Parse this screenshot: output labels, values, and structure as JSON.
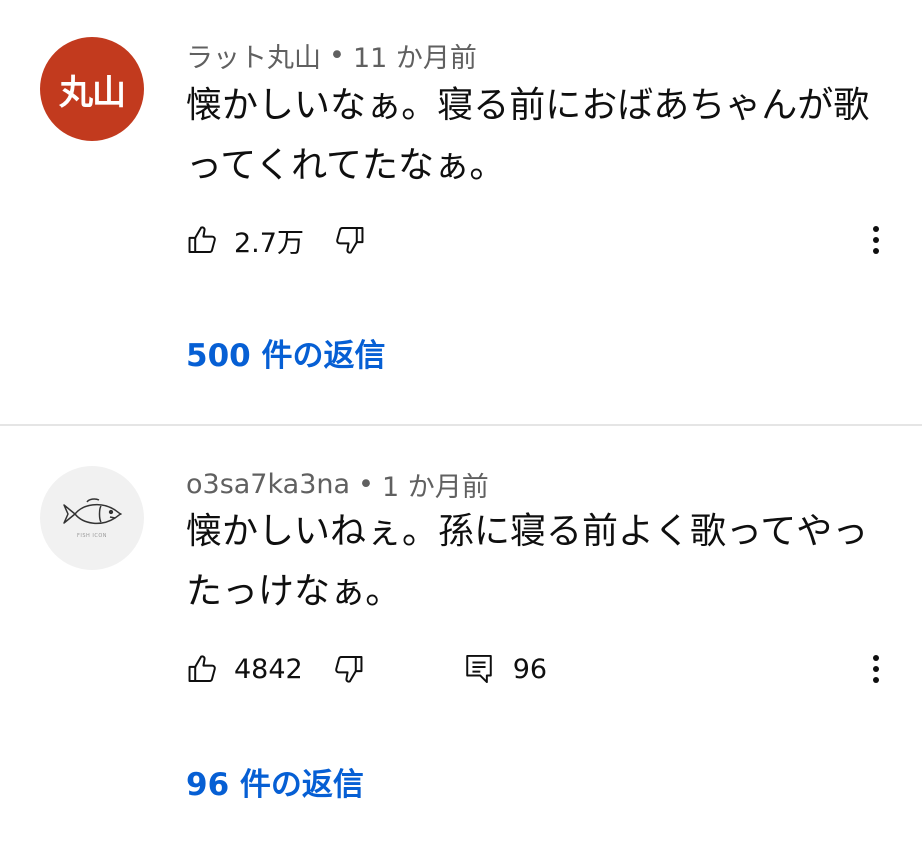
{
  "colors": {
    "link": "#065fd4",
    "meta_text": "#606060",
    "body_text": "#0f0f0f",
    "avatar1_bg": "#c23a1e",
    "avatar2_bg": "#f1f1f1",
    "divider": "#e5e5e5"
  },
  "comments": [
    {
      "author": "ラット丸山",
      "separator": "•",
      "time": "11 か月前",
      "avatar_text": "丸山",
      "text": "懐かしいなぁ。寝る前におばあちゃんが歌ってくれてたなぁ。",
      "likes": "2.7万",
      "replies_link": "500 件の返信",
      "icons": {
        "like": "thumbs-up-icon",
        "dislike": "thumbs-down-icon",
        "more": "more-vertical-icon"
      }
    },
    {
      "author": "o3sa7ka3na",
      "separator": "•",
      "time": "1 か月前",
      "avatar_text": "FISH ICON",
      "text": "懐かしいねぇ。孫に寝る前よく歌ってやったっけなぁ。",
      "likes": "4842",
      "reply_count": "96",
      "replies_link": "96 件の返信",
      "icons": {
        "like": "thumbs-up-icon",
        "dislike": "thumbs-down-icon",
        "reply": "reply-icon",
        "more": "more-vertical-icon"
      }
    }
  ]
}
